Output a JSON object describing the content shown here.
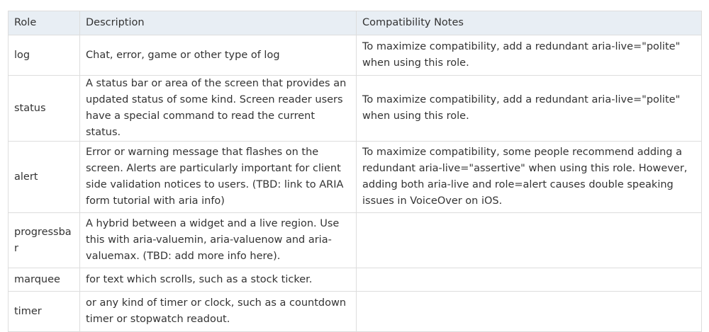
{
  "table": {
    "headers": {
      "role": "Role",
      "description": "Description",
      "notes": "Compatibility Notes"
    },
    "rows": [
      {
        "role": "log",
        "description": "Chat, error, game or other type of log",
        "notes": "To maximize compatibility, add a redundant aria-live=\"polite\" when using this role."
      },
      {
        "role": "status",
        "description": "A status bar or area of the screen that provides an updated status of some kind. Screen reader users have a special command to read the current status.",
        "notes": "To maximize compatibility, add a redundant aria-live=\"polite\" when using this role."
      },
      {
        "role": "alert",
        "description": "Error or warning message that flashes on the screen. Alerts are particularly important for client side validation notices to users. (TBD: link to ARIA form tutorial with aria info)",
        "notes": "To maximize compatibility, some people recommend adding a redundant aria-live=\"assertive\" when using this role. However, adding both aria-live and role=alert causes double speaking issues in VoiceOver on iOS."
      },
      {
        "role": "progressbar",
        "description": "A hybrid between a widget and a live region. Use this with aria-valuemin, aria-valuenow and aria-valuemax. (TBD: add more info here).",
        "notes": ""
      },
      {
        "role": "marquee",
        "description": "for text which scrolls, such as a stock ticker.",
        "notes": ""
      },
      {
        "role": "timer",
        "description": "or any kind of timer or clock, such as a countdown timer or stopwatch readout.",
        "notes": ""
      }
    ]
  }
}
